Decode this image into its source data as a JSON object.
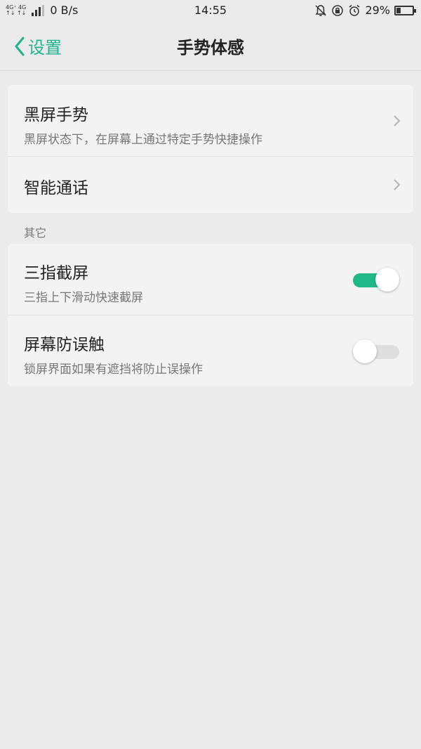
{
  "status_bar": {
    "network_top": "4G⁺ 4G",
    "network_bottom": "↑↓ ↑↓",
    "speed": "0 B/s",
    "time": "14:55",
    "battery_percent": "29%",
    "battery_level": 0.29
  },
  "nav": {
    "back_label": "设置",
    "title": "手势体感"
  },
  "section1": {
    "items": [
      {
        "title": "黑屏手势",
        "subtitle": "黑屏状态下，在屏幕上通过特定手势快捷操作"
      },
      {
        "title": "智能通话"
      }
    ]
  },
  "section2": {
    "label": "其它",
    "items": [
      {
        "title": "三指截屏",
        "subtitle": "三指上下滑动快速截屏",
        "toggle": true
      },
      {
        "title": "屏幕防误触",
        "subtitle": "锁屏界面如果有遮挡将防止误操作",
        "toggle": false
      }
    ]
  },
  "colors": {
    "accent": "#21b888",
    "background": "#ebebeb",
    "card": "#f3f3f3"
  }
}
